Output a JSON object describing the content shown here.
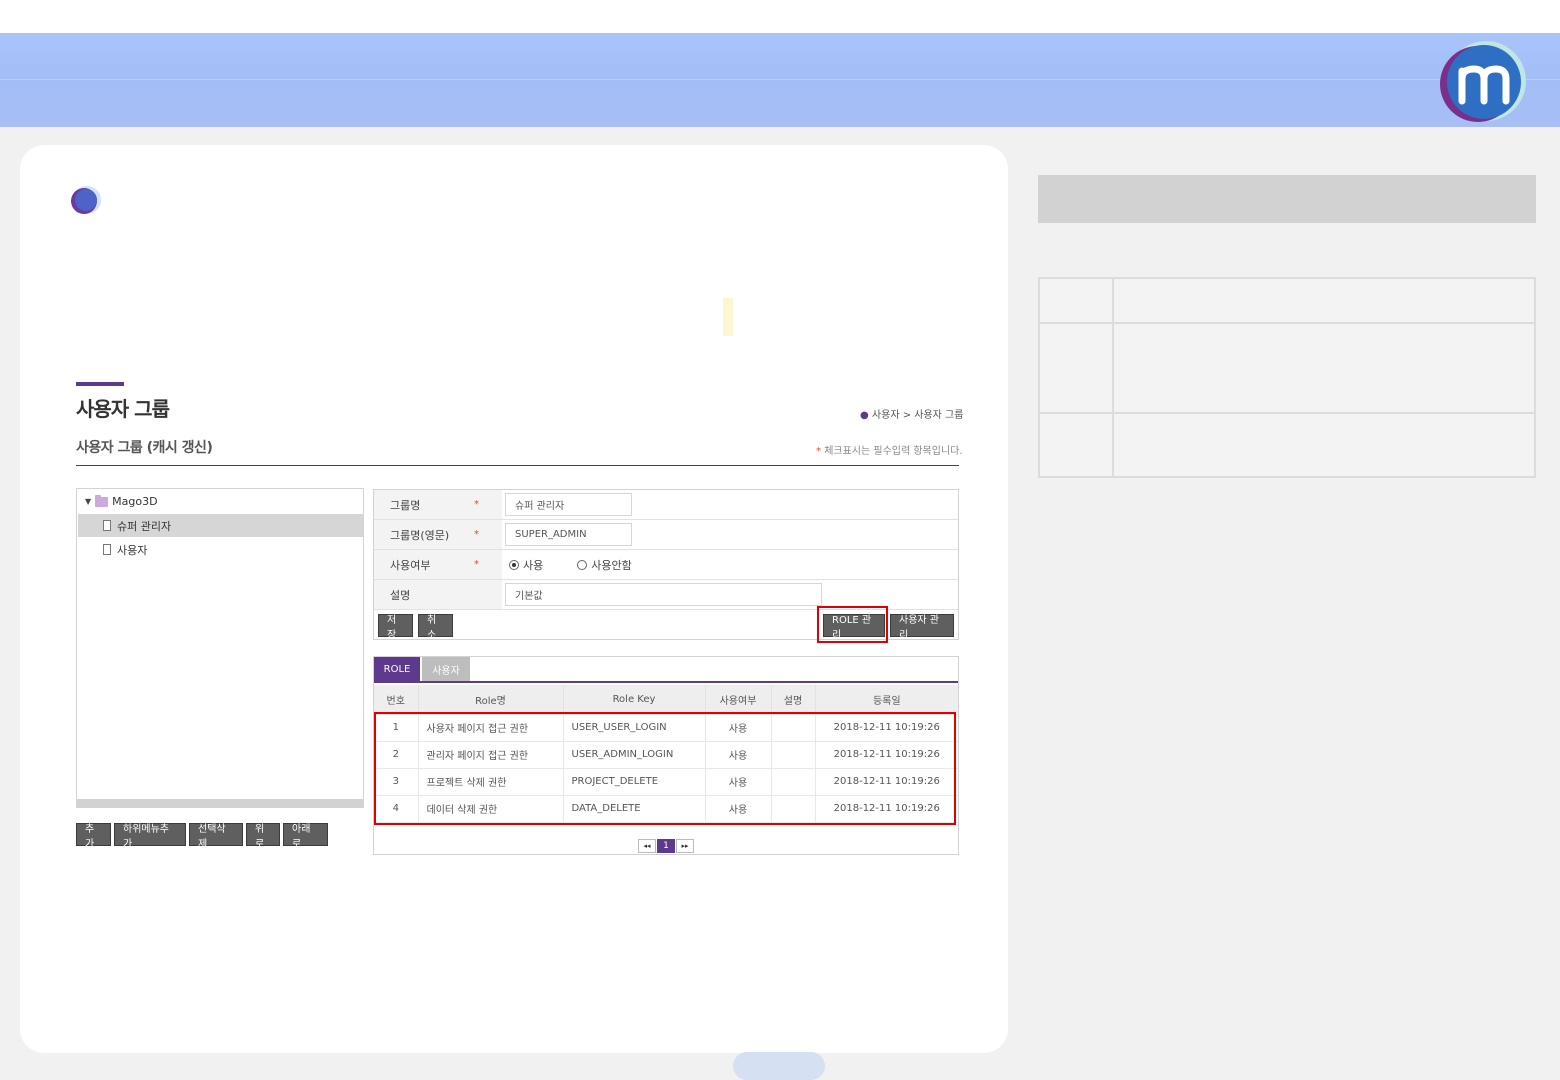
{
  "page": {
    "title": "사용자 그룹",
    "subtitle": "사용자 그룹 (캐시 갱신)",
    "breadcrumb": "사용자 > 사용자 그룹",
    "required_note": "체크표시는 필수입력 항목입니다."
  },
  "tree": {
    "root": "Mago3D",
    "items": [
      "슈퍼 관리자",
      "사용자"
    ],
    "selected": "슈퍼 관리자",
    "buttons": [
      "추가",
      "하위메뉴추가",
      "선택삭제",
      "위로",
      "아래로"
    ]
  },
  "form": {
    "fields": {
      "group_name": {
        "label": "그룹명",
        "value": "슈퍼 관리자"
      },
      "group_name_en": {
        "label": "그룹명(영문)",
        "value": "SUPER_ADMIN"
      },
      "use_yn": {
        "label": "사용여부",
        "options": [
          "사용",
          "사용안함"
        ],
        "selected": "사용"
      },
      "description": {
        "label": "설명",
        "value": "기본값"
      }
    },
    "required_mark": "*",
    "buttons": {
      "save": "저장",
      "cancel": "취소",
      "role_manage": "ROLE 관리",
      "user_manage": "사용자 관리"
    }
  },
  "roles": {
    "tabs": [
      "ROLE",
      "사용자"
    ],
    "active_tab": "ROLE",
    "columns": [
      "번호",
      "Role명",
      "Role Key",
      "사용여부",
      "설명",
      "등록일"
    ],
    "rows": [
      {
        "no": "1",
        "name": "사용자 페이지 접근 권한",
        "key": "USER_USER_LOGIN",
        "use": "사용",
        "desc": "",
        "date": "2018-12-11 10:19:26"
      },
      {
        "no": "2",
        "name": "관리자 페이지 접근 권한",
        "key": "USER_ADMIN_LOGIN",
        "use": "사용",
        "desc": "",
        "date": "2018-12-11 10:19:26"
      },
      {
        "no": "3",
        "name": "프로젝트 삭제 권한",
        "key": "PROJECT_DELETE",
        "use": "사용",
        "desc": "",
        "date": "2018-12-11 10:19:26"
      },
      {
        "no": "4",
        "name": "데이터 삭제 권한",
        "key": "DATA_DELETE",
        "use": "사용",
        "desc": "",
        "date": "2018-12-11 10:19:26"
      }
    ],
    "pager": {
      "prev": "◂◂",
      "current": "1",
      "next": "▸▸"
    }
  },
  "colors": {
    "accent": "#5e3a8e",
    "highlight": "#e00000",
    "banner": "#a6c0f8"
  }
}
